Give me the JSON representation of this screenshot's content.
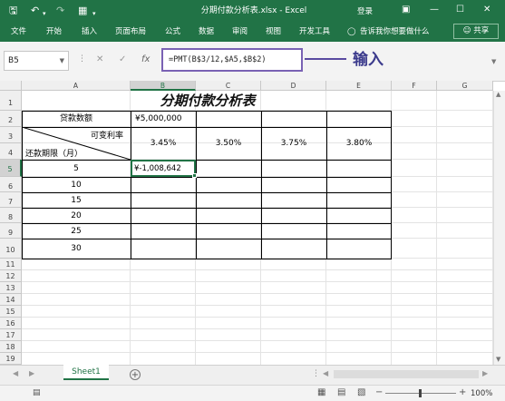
{
  "window": {
    "title": "分期付款分析表.xlsx  -  Excel",
    "login": "登录",
    "qat_icons": [
      "save-icon",
      "undo-icon",
      "redo-icon",
      "customize-icon"
    ],
    "window_icons": [
      "restore-icon",
      "minimize-icon",
      "maximize-icon",
      "close-icon"
    ]
  },
  "ribbon": {
    "tabs": [
      "文件",
      "开始",
      "插入",
      "页面布局",
      "公式",
      "数据",
      "审阅",
      "视图",
      "开发工具"
    ],
    "tell_me": "告诉我你想要做什么",
    "share": "共享"
  },
  "formula_bar": {
    "name_box": "B5",
    "cancel_symbol": "✕",
    "enter_symbol": "✓",
    "fx_symbol": "fx",
    "formula": "=PMT(B$3/12,$A5,$B$2)",
    "annotation": "输入"
  },
  "sheet": {
    "columns": [
      "A",
      "B",
      "C",
      "D",
      "E",
      "F",
      "G"
    ],
    "selected_column": "B",
    "rows": [
      "1",
      "2",
      "3",
      "4",
      "5",
      "6",
      "7",
      "8",
      "9",
      "10",
      "11",
      "12",
      "13",
      "14",
      "15",
      "16",
      "17",
      "18",
      "19"
    ],
    "selected_row": "5",
    "title": "分期付款分析表",
    "loan_label": "贷款数额",
    "loan_value": "¥5,000,000",
    "rate_header": "可变利率",
    "term_header": "还款期限（月）",
    "rates": [
      "3.45%",
      "3.50%",
      "3.75%",
      "3.80%"
    ],
    "terms": [
      "5",
      "10",
      "15",
      "20",
      "25",
      "30"
    ],
    "result_b5": "¥-1,008,642"
  },
  "sheet_tabs": {
    "active": "Sheet1",
    "add_symbol": "+"
  },
  "status_bar": {
    "zoom": "100%",
    "zoom_minus": "−",
    "zoom_plus": "+"
  }
}
